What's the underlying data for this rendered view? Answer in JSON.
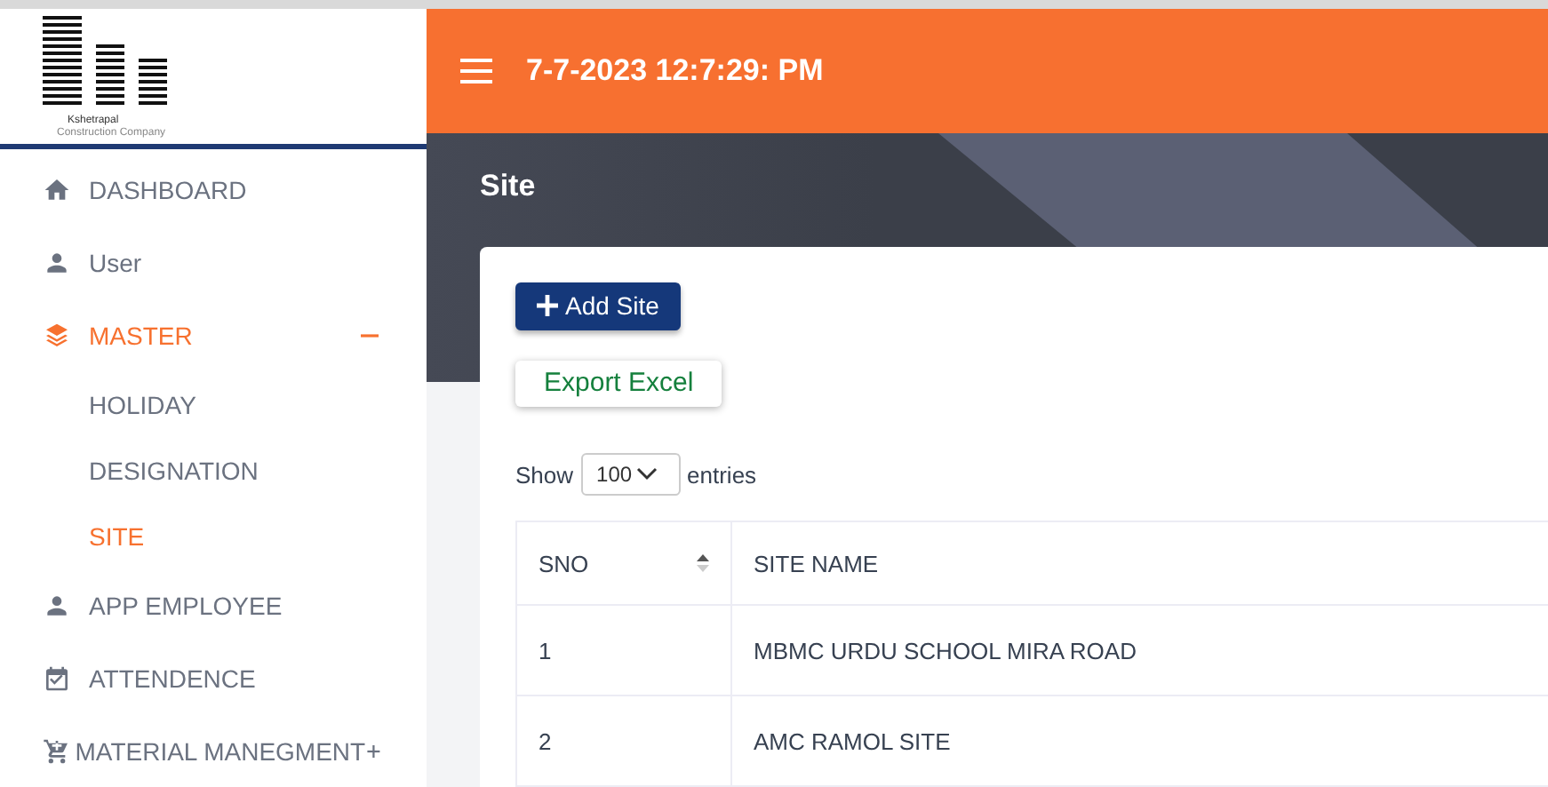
{
  "logo": {
    "line_1": "Kshetrapal",
    "line_2": "Construction Company"
  },
  "nav": [
    {
      "label": "DASHBOARD",
      "selected": false
    },
    {
      "label": "User",
      "selected": false
    },
    {
      "label": "MASTER",
      "selected": true,
      "expanded": true,
      "children": [
        {
          "label": "HOLIDAY",
          "selected": false
        },
        {
          "label": "DESIGNATION",
          "selected": false
        },
        {
          "label": "SITE",
          "selected": true
        }
      ]
    },
    {
      "label": "APP EMPLOYEE",
      "selected": false
    },
    {
      "label": "ATTENDENCE",
      "selected": false
    },
    {
      "label": "MATERIAL MANEGMENT",
      "selected": false,
      "expanded": false
    }
  ],
  "header": {
    "datetime": "7-7-2023 12:7:29: PM"
  },
  "page_title": "Site",
  "buttons": {
    "add": "Add Site",
    "export": "Export Excel"
  },
  "length_control": {
    "before": "Show",
    "value": "100",
    "after": "entries"
  },
  "table": {
    "columns": [
      "SNO",
      "SITE NAME"
    ],
    "rows": [
      [
        "1",
        "MBMC URDU SCHOOL MIRA ROAD"
      ],
      [
        "2",
        "AMC RAMOL SITE"
      ]
    ]
  }
}
